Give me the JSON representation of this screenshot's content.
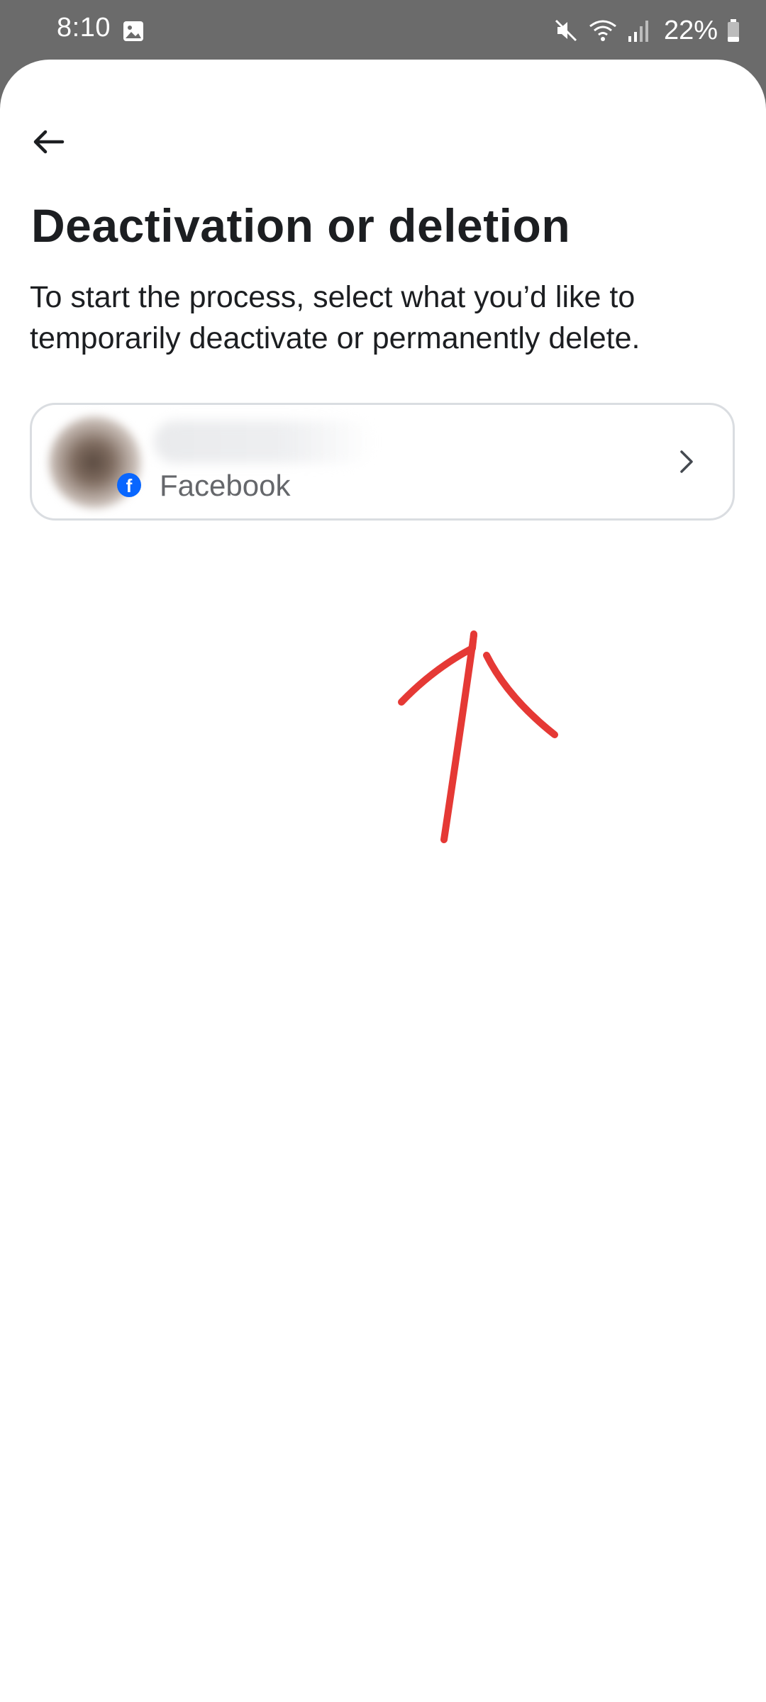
{
  "status_bar": {
    "time": "8:10",
    "battery": "22%",
    "icons": [
      "gallery-icon",
      "mute-icon",
      "wifi-icon",
      "signal-icon",
      "battery-icon"
    ]
  },
  "header": {
    "back_icon": "back-arrow-icon"
  },
  "main": {
    "title": "Deactivation or deletion",
    "subtitle": "To start the process, select what you’d like to temporarily deactivate or permanently delete."
  },
  "account_card": {
    "name": "",
    "platform": "Facebook",
    "badge_letter": "f",
    "chevron_icon": "chevron-right-icon"
  },
  "annotation": {
    "type": "red-arrow-icon",
    "color": "#e53935"
  },
  "colors": {
    "status_bar": "#6b6b6b",
    "background": "#ffffff",
    "text_primary": "#1c1e21",
    "text_secondary": "#65676b",
    "card_border": "#dadde1",
    "facebook_blue": "#0866ff"
  }
}
